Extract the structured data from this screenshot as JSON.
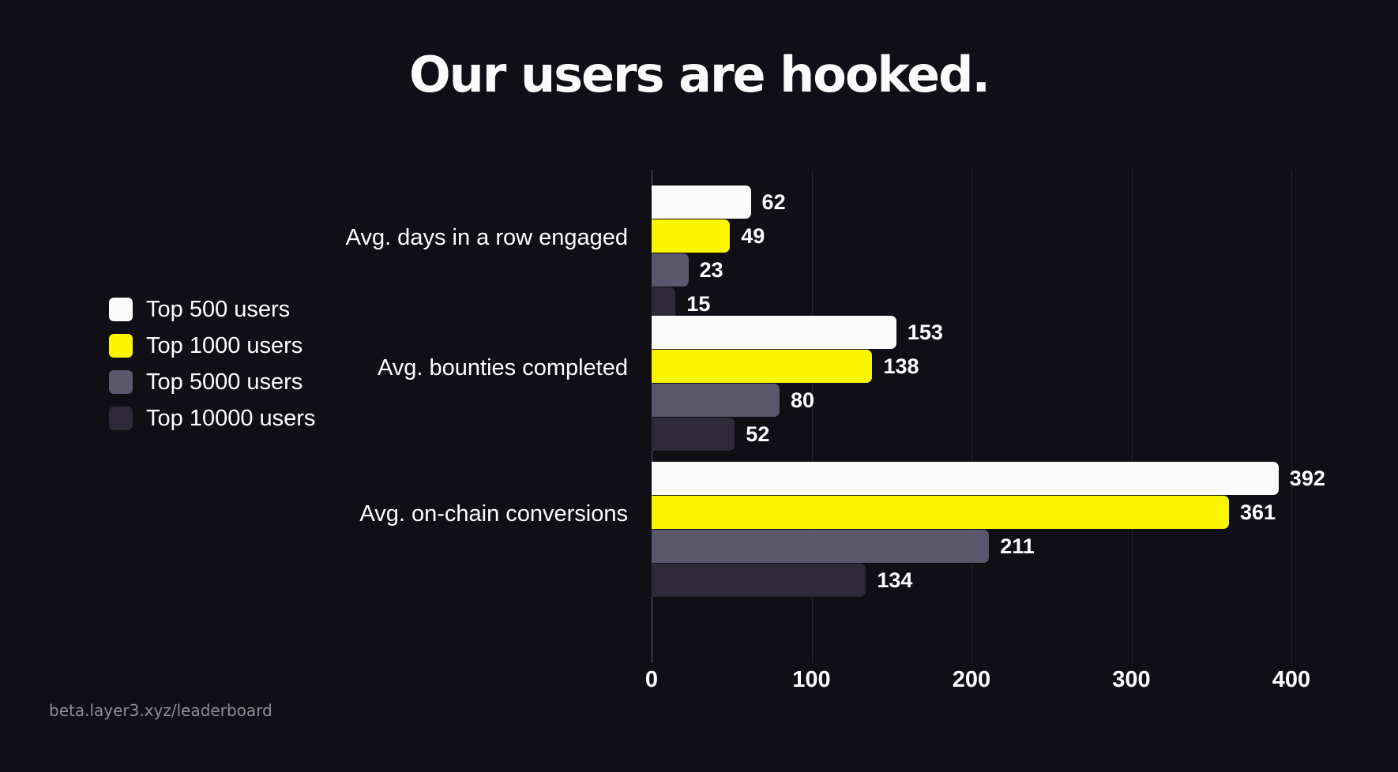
{
  "title": "Our users are hooked.",
  "footer": {
    "url": "beta.layer3.xyz/leaderboard"
  },
  "colors": {
    "background": "#100f15",
    "top500": "#fbfbfc",
    "top1000": "#fbf500",
    "top5000": "#5a566b",
    "top10000": "#2e2a3a",
    "gridline": "#26242e",
    "axis": "#5b5866",
    "text": "#ffffff",
    "footer_text": "#8d8c96"
  },
  "legend": {
    "items": [
      {
        "label": "Top 500 users",
        "color": "#fbfbfc"
      },
      {
        "label": "Top 1000 users",
        "color": "#fbf500"
      },
      {
        "label": "Top 5000 users",
        "color": "#5a566b"
      },
      {
        "label": "Top 10000 users",
        "color": "#2e2a3a"
      }
    ]
  },
  "chart_data": {
    "type": "bar",
    "orientation": "horizontal",
    "title": "Our users are hooked.",
    "xlabel": "",
    "ylabel": "",
    "xlim": [
      0,
      400
    ],
    "xticks": [
      0,
      100,
      200,
      300,
      400
    ],
    "grid": true,
    "legend_position": "left",
    "categories": [
      "Avg. days in a row engaged",
      "Avg. bounties completed",
      "Avg. on-chain conversions"
    ],
    "series": [
      {
        "name": "Top 500 users",
        "color": "#fbfbfc",
        "values": [
          62,
          153,
          392
        ]
      },
      {
        "name": "Top 1000 users",
        "color": "#fbf500",
        "values": [
          49,
          138,
          361
        ]
      },
      {
        "name": "Top 5000 users",
        "color": "#5a566b",
        "values": [
          23,
          80,
          211
        ]
      },
      {
        "name": "Top 10000 users",
        "color": "#2e2a3a",
        "values": [
          15,
          52,
          134
        ]
      }
    ]
  }
}
